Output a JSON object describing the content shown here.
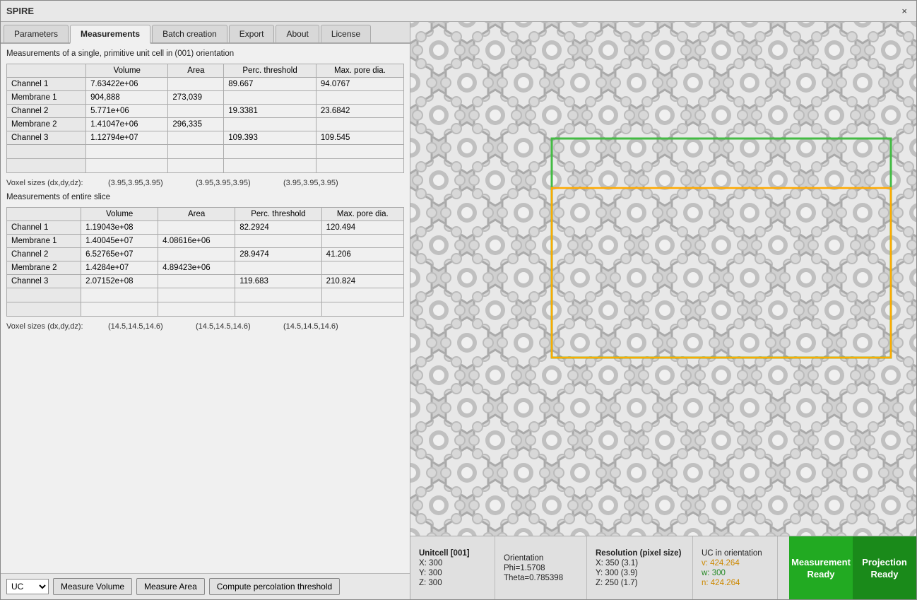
{
  "window": {
    "title": "SPIRE",
    "close_label": "×"
  },
  "tabs": [
    {
      "id": "parameters",
      "label": "Parameters",
      "active": false
    },
    {
      "id": "measurements",
      "label": "Measurements",
      "active": true
    },
    {
      "id": "batch",
      "label": "Batch creation",
      "active": false
    },
    {
      "id": "export",
      "label": "Export",
      "active": false
    },
    {
      "id": "about",
      "label": "About",
      "active": false
    },
    {
      "id": "license",
      "label": "License",
      "active": false
    }
  ],
  "measurements": {
    "primitive_label": "Measurements of a single, primitive unit cell in (001) orientation",
    "primitive_table": {
      "headers": [
        "",
        "Volume",
        "Area",
        "Perc. threshold",
        "Max. pore dia."
      ],
      "rows": [
        [
          "Channel 1",
          "7.63422e+06",
          "",
          "89.667",
          "94.0767"
        ],
        [
          "Membrane 1",
          "904,888",
          "273,039",
          "",
          ""
        ],
        [
          "Channel 2",
          "5.771e+06",
          "",
          "19.3381",
          "23.6842"
        ],
        [
          "Membrane 2",
          "1.41047e+06",
          "296,335",
          "",
          ""
        ],
        [
          "Channel 3",
          "1.12794e+07",
          "",
          "109.393",
          "109.545"
        ]
      ]
    },
    "voxel_primitive": {
      "label": "Voxel sizes (dx,dy,dz):",
      "val1": "(3.95,3.95,3.95)",
      "val2": "(3.95,3.95,3.95)",
      "val3": "(3.95,3.95,3.95)"
    },
    "slice_label": "Measurements of entire slice",
    "slice_table": {
      "headers": [
        "",
        "Volume",
        "Area",
        "Perc. threshold",
        "Max. pore dia."
      ],
      "rows": [
        [
          "Channel 1",
          "1.19043e+08",
          "",
          "82.2924",
          "120.494"
        ],
        [
          "Membrane 1",
          "1.40045e+07",
          "4.08616e+06",
          "",
          ""
        ],
        [
          "Channel 2",
          "6.52765e+07",
          "",
          "28.9474",
          "41.206"
        ],
        [
          "Membrane 2",
          "1.4284e+07",
          "4.89423e+06",
          "",
          ""
        ],
        [
          "Channel 3",
          "2.07152e+08",
          "",
          "119.683",
          "210.824"
        ]
      ]
    },
    "voxel_slice": {
      "label": "Voxel sizes (dx,dy,dz):",
      "val1": "(14.5,14.5,14.6)",
      "val2": "(14.5,14.5,14.6)",
      "val3": "(14.5,14.5,14.6)"
    }
  },
  "controls": {
    "dropdown_label": "UC",
    "dropdown_options": [
      "UC"
    ],
    "btn1": "Measure Volume",
    "btn2": "Measure Area",
    "btn3": "Compute percolation threshold"
  },
  "bottom_bar": {
    "unitcell": {
      "label": "Unitcell [001]",
      "x": "X: 300",
      "y": "Y: 300",
      "z": "Z: 300"
    },
    "orientation": {
      "phi_label": "Phi=1.5708",
      "theta_label": "Theta=0.785398",
      "orientation_label": "Orientation"
    },
    "resolution": {
      "label": "Resolution (pixel size)",
      "x": "X:  350 (3.1)",
      "y": "Y:  300 (3.9)",
      "z": "Z:  250 (1.7)"
    },
    "uc_orientation": {
      "label": "UC in orientation",
      "v": "v: 424.264",
      "w": "w: 300",
      "n": "n: 424.264"
    },
    "status_measurement": {
      "line1": "Measurement",
      "line2": "Ready"
    },
    "status_projection": {
      "line1": "Projection",
      "line2": "Ready"
    }
  }
}
